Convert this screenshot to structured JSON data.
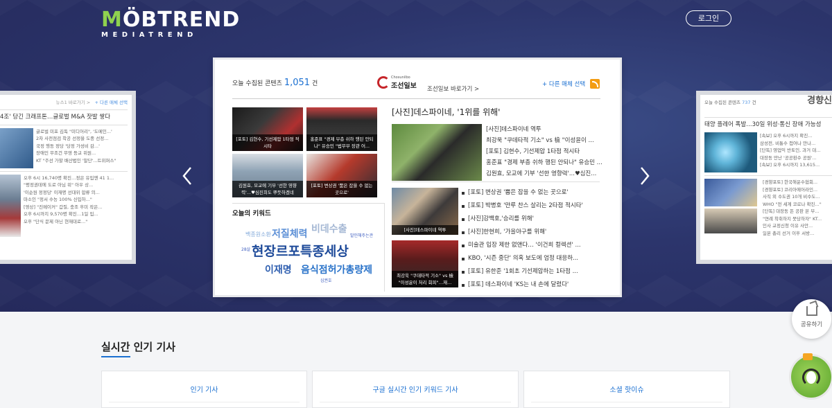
{
  "header": {
    "logo_main": "MOBTREND",
    "logo_sub": "MEDIATREND",
    "login_label": "로그인"
  },
  "carousel": {
    "left_card": {
      "goto": "뉴스1 바로가기 >",
      "other": "+ 다른 매체 선택",
      "headline": "4조' 당긴 크래프톤…글로벌 M&A 잣발 쌓다",
      "items": [
        "글로벌 미포 김독 \"미디어리\", '도메인...'",
        "2차 사전점검 착공 선정을 도중 선정...",
        "국정 행동 정당 '당정 가성비 감...'",
        "장애인 무조건 무영 등교 위원...",
        "KT \"주선 가할 배산법인 '말단'...트위퍼스\""
      ],
      "list": [
        "오후 6시 16,740명 확진…정은 유입엔 41 1...",
        "\"평정권데에 도로 아님 위\" 아우 상...",
        "'이순원 정정당' 이재명 선대위 합류 의...",
        "마소인 \"정서 수능 100% 신입하...\"",
        "[영상] \"진메이커\" 갑질, 충조 후미 작은...",
        "오후 6시까지 9,570명 확진…1일 입...",
        "오후 \"단식 문제 아닌 현재대로...\""
      ]
    },
    "right_card": {
      "count_label": "오늘 수집된 콘텐츠",
      "count": "737",
      "unit": "건",
      "paper": "경향신",
      "headline": "태양 플레어 폭발…30일 위성·통신 장애 가능성",
      "items": [
        "[속보] 오후 6시까지 확진...",
        "삼성전, 비통수 접여나 만나...",
        "[단독] 영업익 반토인, 과거 대...",
        "대장동 만난 '공공환수 공원'...",
        "[속보] 오후 6시까지 13,615..."
      ],
      "list": [
        "[경향포토] 한국해운수협회...",
        "[경향포토] 코리아에어라인...",
        "사직 외 수도권 10개 비수도...",
        "WHO \"전 세계 코로나 확진...\"",
        "[단독] 대장동 돈 공판 본 부...",
        "\"연례 착취하지 못당하자\" KT...",
        "인사 교정신청 이유 사안...",
        "일본 총리 선거 이후 서방..."
      ]
    },
    "main_card": {
      "count_label": "오늘 수집된 콘텐츠",
      "count": "1,051",
      "unit": "건",
      "paper_en": "Chosunilbo",
      "paper_ko": "조선일보",
      "goto_label": "조선일보 바로가기 >",
      "other_media": "+ 다른 매체 선택",
      "thumbs": [
        "[포토] 김현수, 기선제압 1타점 적시타",
        "홍준표 \"경제 부층 쉬하 행된 안되나\" 유승민 \"법무부 장관 어...",
        "김원효, 모교에 기부 '선한 영향력'...♥심진희도 뿌듯하겠네",
        "[포토] 변상권 '뿜은 잡을 수 없는 곳으로'"
      ],
      "keyword_title": "오늘의 키워드",
      "keywords": [
        {
          "text": "백종원소환",
          "size": 8,
          "color": "#7fa7d9"
        },
        {
          "text": "저질체력",
          "size": 14,
          "color": "#5c8fd6"
        },
        {
          "text": "비데수출",
          "size": 14,
          "color": "#a5b8d4"
        },
        {
          "text": "발인해주는관",
          "size": 6,
          "color": "#3f5fc0"
        },
        {
          "text": "28살",
          "size": 6,
          "color": "#3f5fc0"
        },
        {
          "text": "현장르포특종세상",
          "size": 19,
          "color": "#1f4b9a"
        },
        {
          "text": "이재명",
          "size": 14,
          "color": "#2f5fb0"
        },
        {
          "text": "음식점허가총량제",
          "size": 14,
          "color": "#2a73c9"
        },
        {
          "text": "심권호",
          "size": 6,
          "color": "#3f5fc0"
        }
      ],
      "headline": "[사진]데스파이네, '1위를 위해'",
      "top_list": [
        "[사진]데스파이네 역투",
        "최강욱 \"쿠데타적 기소\" vs 檢 \"이성윤이 ...",
        "[포토] 김현수, 기선제압 1타점 적시타",
        "홍준표 \"경제 부층 쉬하 행된 안되나\" 유승민 ...",
        "김원효, 모교에 기부 '선한 영향력'...♥심진..."
      ],
      "mid_caption_1": "[사진]데스파이네 역투",
      "mid_caption_2": "최강욱 \"쿠데타적 기소\" vs 檢 \"이성윤이 처리 회피\"…재...",
      "bullets": [
        "[포토] 변상권 '뿜은 잡을 수 없는 곳으로'",
        "[포토] 박병호 '만루 찬스 살리는 2타점 적시타'",
        "[사진]강백호,'승리를 위해'",
        "[사진]한현희, '가을야구를 위해'",
        "미술관 입장 제한 없앤다… '이건희 컬렉션' ...",
        "KBO, '시즌 중단' 의혹 보도에 엄정 대응하...",
        "[포토] 유한준 '1회초 기선제압하는 1타점 ...",
        "[포토] 데스파이네 'KS는 내 손에 달렸다'"
      ]
    }
  },
  "floating": {
    "share_label": "공유하기"
  },
  "section": {
    "title": "실시간 인기 기사",
    "tabs": [
      "인기 기사",
      "구글 실시간 인기 키워드 기사",
      "소셜 핫이슈"
    ]
  },
  "colors": {
    "accent": "#1a6fd1",
    "logo_green": "#8fd14f",
    "hero_bg": "#2c356c"
  }
}
